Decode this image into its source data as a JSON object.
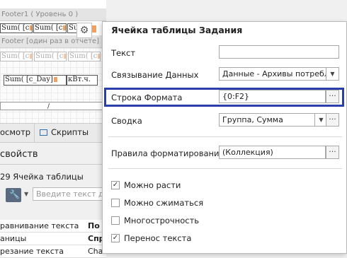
{
  "designer": {
    "footer_band": "Footer1 ( Уровень 0 )",
    "top_cells": [
      "Sum( [c",
      "Sum( [c",
      "Su"
    ],
    "report_footer_band": "Footer [один раз в отчете]",
    "gray_cells": [
      "Sum( [c",
      "Sum( [c",
      "Sum( [c"
    ],
    "day_cell": "Sum( [c_Day]",
    "unit_cell": "кВт.ч.",
    "slash_cell": "/"
  },
  "tabs": {
    "preview": "осмотр",
    "scripts": "Скрипты"
  },
  "properties": {
    "title": "свойств",
    "selected_object": "29  Ячейка таблицы",
    "filter_placeholder": "Введите текст д",
    "rows": [
      {
        "name": "равнивание текста",
        "value": "По с"
      },
      {
        "name": "аницы",
        "value": "Спр"
      },
      {
        "name": "резание текста",
        "value": "Chars"
      }
    ]
  },
  "popup": {
    "title": "Ячейка таблицы Задания",
    "text_label": "Текст",
    "text_value": "",
    "binding_label": "Связывание Данных",
    "binding_value": "Данные - Архивы потреблен",
    "format_label": "Строка Формата",
    "format_value": "{0:F2}",
    "summary_label": "Сводка",
    "summary_value": "Группа, Сумма",
    "rules_label": "Правила форматирования",
    "rules_value": "(Коллекция)",
    "ellipsis": "···",
    "checkboxes": [
      {
        "label": "Можно расти",
        "checked": true
      },
      {
        "label": "Можно сжиматься",
        "checked": false
      },
      {
        "label": "Многострочность",
        "checked": false
      },
      {
        "label": "Перенос текста",
        "checked": true
      }
    ]
  },
  "icons": {
    "gear": "gear-icon",
    "wrench": "wrench-icon",
    "check": "check-icon",
    "dropdown": "chevron-down-icon"
  },
  "colors": {
    "highlight": "#2a3fa8",
    "accent": "#3070b0"
  }
}
